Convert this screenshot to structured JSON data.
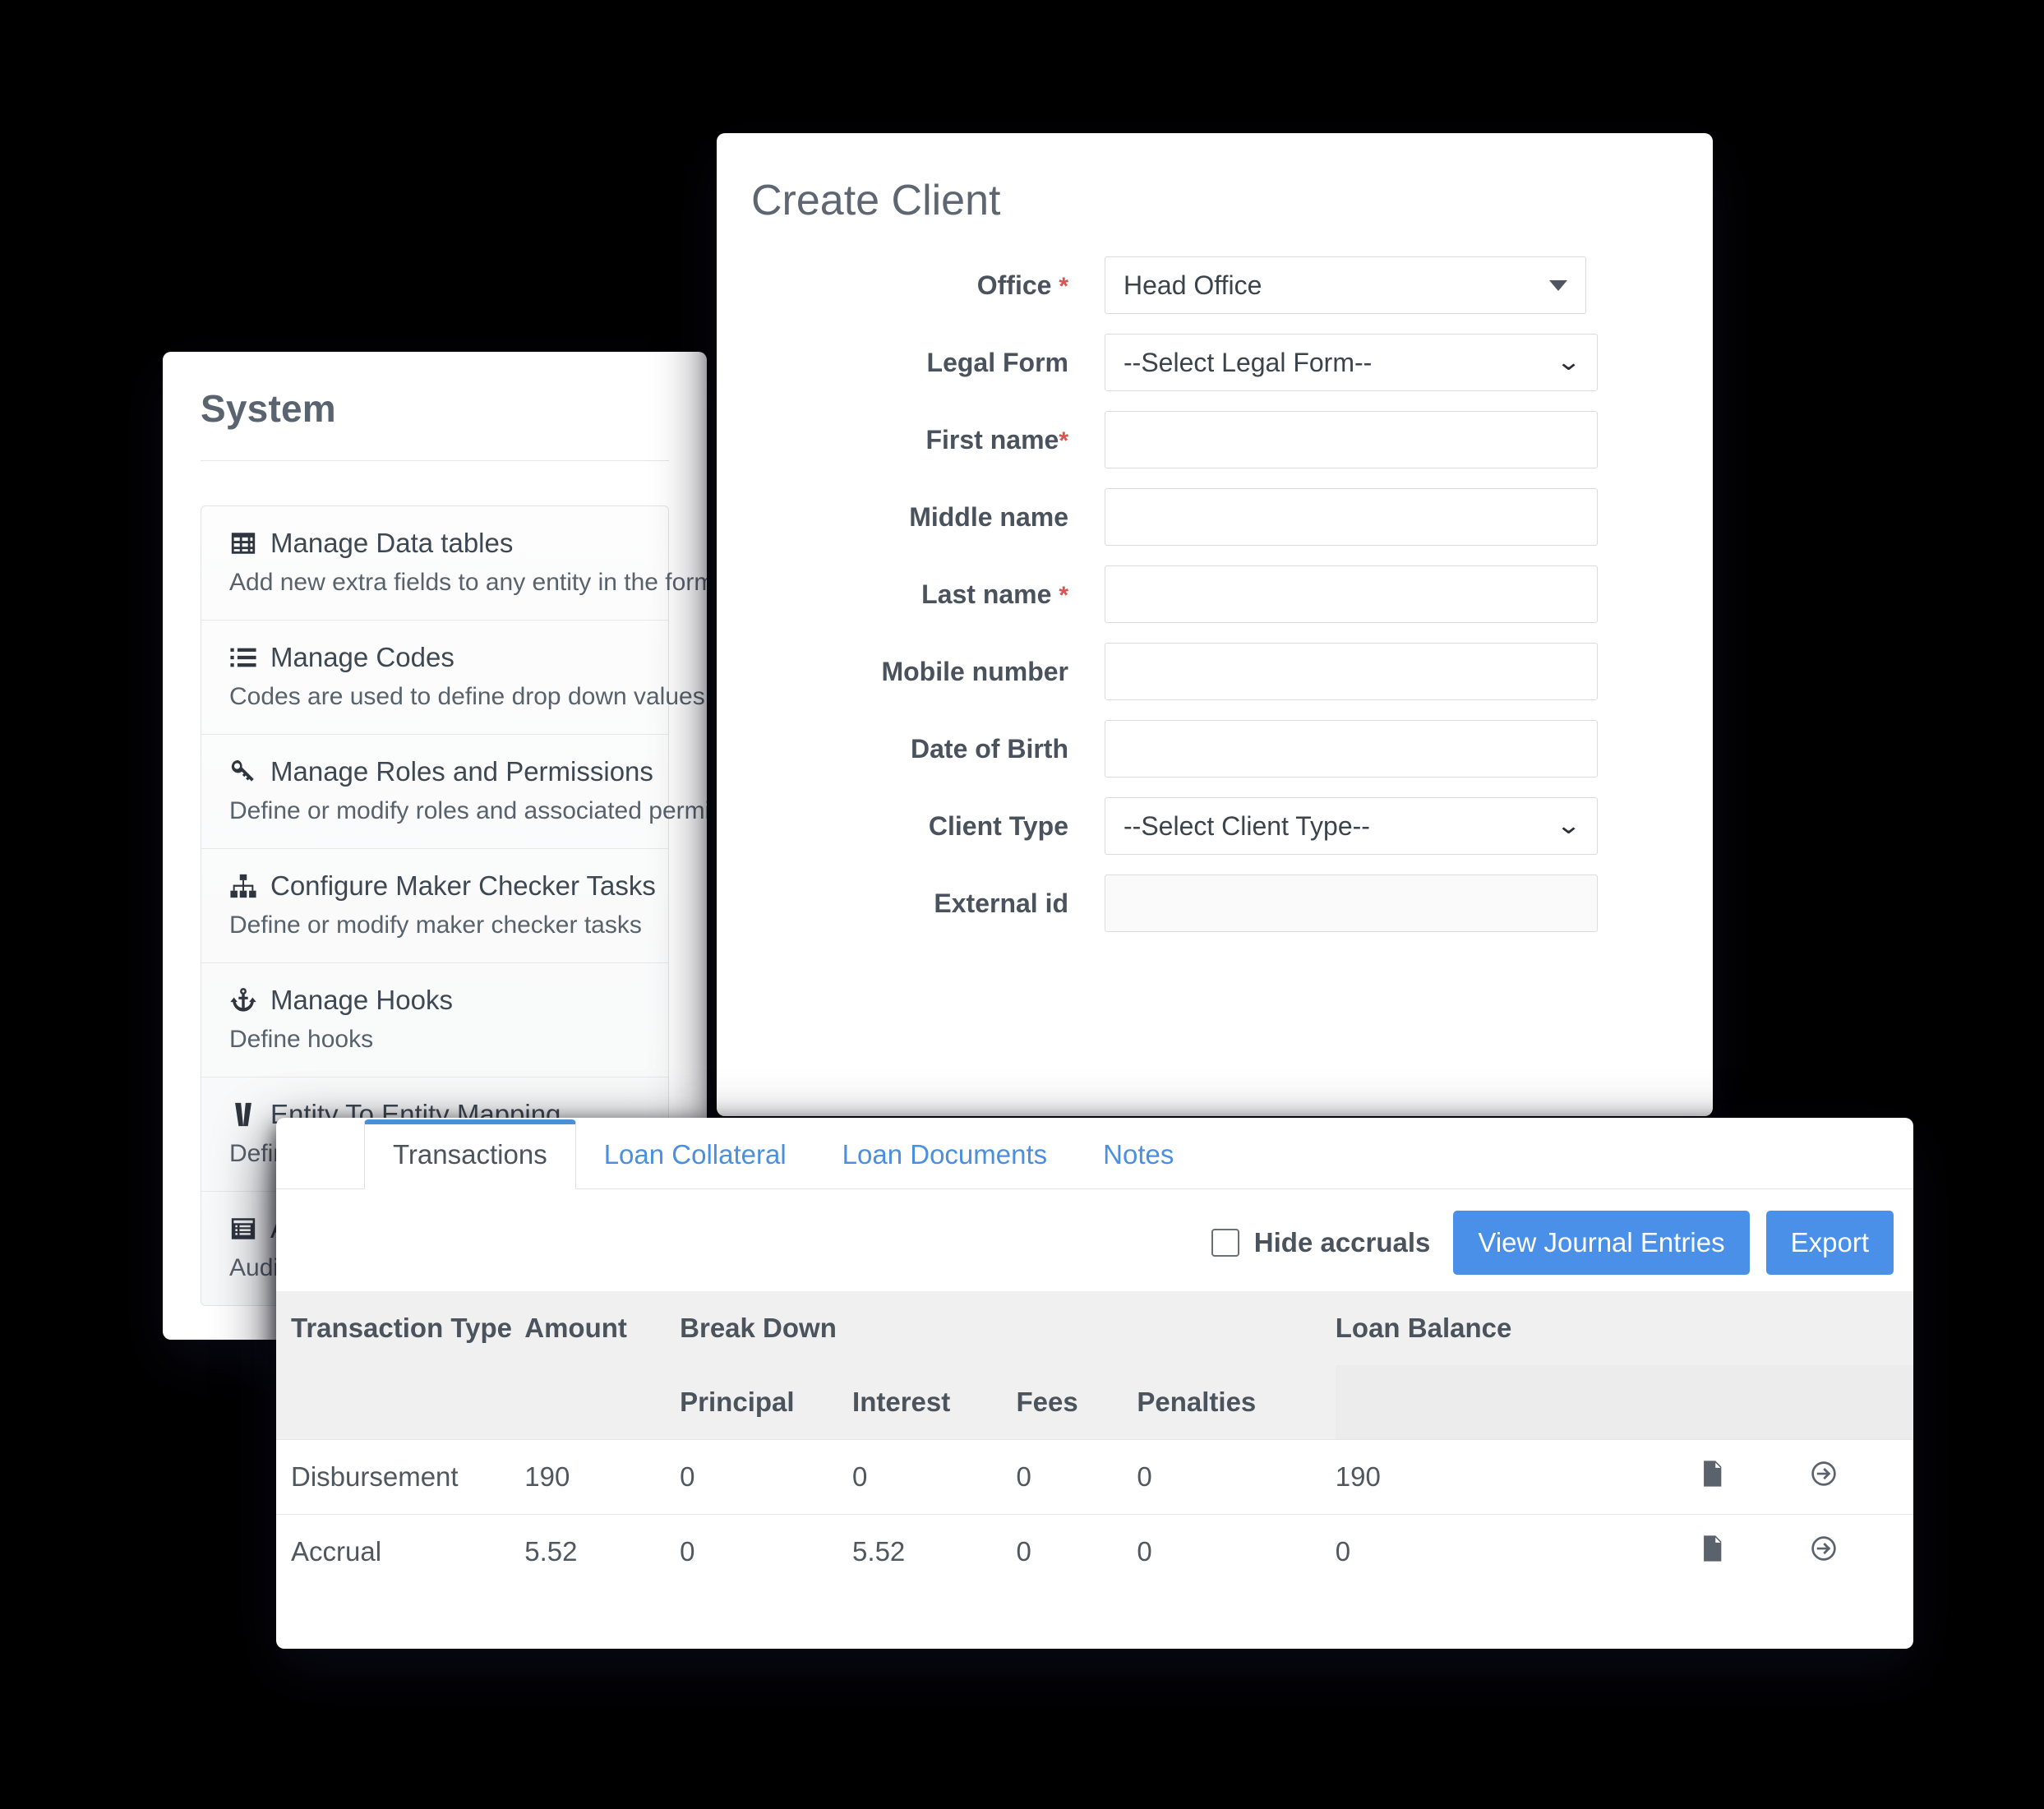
{
  "system_panel": {
    "title": "System",
    "items": [
      {
        "icon": "table-grid-icon",
        "label": "Manage Data tables",
        "desc": "Add new extra fields to any entity in the form"
      },
      {
        "icon": "list-ul-icon",
        "label": "Manage Codes",
        "desc": "Codes are used to define drop down values"
      },
      {
        "icon": "key-icon",
        "label": "Manage Roles and Permissions",
        "desc": "Define or modify roles and associated permi"
      },
      {
        "icon": "sitemap-icon",
        "label": "Configure Maker Checker Tasks",
        "desc": "Define or modify maker checker tasks"
      },
      {
        "icon": "anchor-icon",
        "label": "Manage Hooks",
        "desc": "Define hooks"
      },
      {
        "icon": "entity-map-icon",
        "label": "Entity To Entity Mapping",
        "desc": "Defin"
      },
      {
        "icon": "audit-list-icon",
        "label": "A",
        "desc": "Audit"
      }
    ]
  },
  "create_client": {
    "title": "Create Client",
    "fields": [
      {
        "label": "Office",
        "required": true,
        "type": "select-triangle",
        "value": "Head Office"
      },
      {
        "label": "Legal Form",
        "required": false,
        "type": "select-chevron",
        "value": "--Select Legal Form--"
      },
      {
        "label": "First name",
        "required": true,
        "required_tight": true,
        "type": "text",
        "value": ""
      },
      {
        "label": "Middle name",
        "required": false,
        "type": "text",
        "value": ""
      },
      {
        "label": "Last name",
        "required": true,
        "type": "text",
        "value": ""
      },
      {
        "label": "Mobile number",
        "required": false,
        "type": "text",
        "value": ""
      },
      {
        "label": "Date of Birth",
        "required": false,
        "type": "text",
        "value": ""
      },
      {
        "label": "Client Type",
        "required": false,
        "type": "select-chevron",
        "value": "--Select Client Type--"
      },
      {
        "label": "External id",
        "required": false,
        "type": "text-muted",
        "value": ""
      }
    ]
  },
  "transactions_panel": {
    "tabs": [
      {
        "label": "Transactions",
        "active": true
      },
      {
        "label": "Loan Collateral",
        "active": false
      },
      {
        "label": "Loan Documents",
        "active": false
      },
      {
        "label": "Notes",
        "active": false
      }
    ],
    "toolbar": {
      "hide_accruals_label": "Hide accruals",
      "hide_accruals_checked": false,
      "view_journal_entries_label": "View Journal Entries",
      "export_label": "Export"
    },
    "table": {
      "headers_top": [
        "Transaction Type",
        "Amount",
        "Break Down",
        "",
        "",
        "",
        "Loan Balance",
        "",
        ""
      ],
      "headers_sub": [
        "",
        "",
        "Principal",
        "Interest",
        "Fees",
        "Penalties",
        "",
        "",
        ""
      ],
      "rows": [
        {
          "type": "Disbursement",
          "amount": "190",
          "principal": "0",
          "interest": "0",
          "fees": "0",
          "penalties": "0",
          "balance": "190",
          "icon1": "file-text-icon",
          "icon2": "arrow-circle-right-icon"
        },
        {
          "type": "Accrual",
          "amount": "5.52",
          "principal": "0",
          "interest": "5.52",
          "fees": "0",
          "penalties": "0",
          "balance": "0",
          "icon1": "file-text-icon",
          "icon2": "arrow-circle-right-icon"
        }
      ]
    }
  },
  "colors": {
    "accent_blue": "#4a90e8",
    "tab_link_blue": "#4b8fe0",
    "required_red": "#d9534f",
    "background": "#000000",
    "card_white": "#ffffff",
    "header_gray": "#f0f0f0"
  }
}
